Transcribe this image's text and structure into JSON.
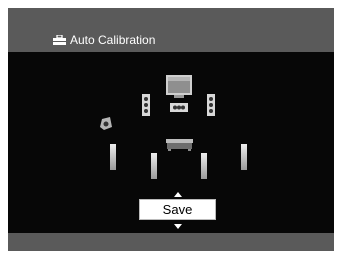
{
  "header": {
    "title": "Auto Calibration",
    "icon": "toolbox-icon"
  },
  "speaker_layout": {
    "speakers": [
      {
        "name": "tv-screen-icon"
      },
      {
        "name": "front-left-speaker"
      },
      {
        "name": "center-speaker"
      },
      {
        "name": "front-right-speaker"
      },
      {
        "name": "subwoofer"
      },
      {
        "name": "surround-left-speaker"
      },
      {
        "name": "surround-back-left-speaker"
      },
      {
        "name": "listening-position"
      },
      {
        "name": "surround-back-right-speaker"
      },
      {
        "name": "surround-right-speaker"
      }
    ]
  },
  "action": {
    "save_label": "Save"
  },
  "colors": {
    "frame": "#5a5a5a",
    "stage": "#070707",
    "text": "#ffffff",
    "selection_bg": "#ffffff"
  }
}
